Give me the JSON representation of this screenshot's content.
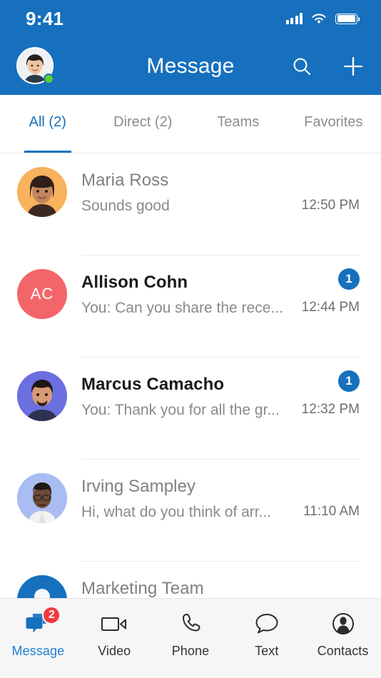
{
  "status_bar": {
    "time": "9:41",
    "signal_icon": "signal-bars-icon",
    "wifi_icon": "wifi-icon",
    "battery_icon": "battery-full-icon"
  },
  "header": {
    "title": "Message",
    "background_color": "#1670bd",
    "avatar_name": "user-avatar",
    "presence": "online",
    "presence_color": "#5ece2b",
    "search_icon": "search-icon",
    "add_icon": "plus-icon"
  },
  "tabs": {
    "active_index": 0,
    "accent_color": "#1670bd",
    "items": [
      {
        "label": "All (2)"
      },
      {
        "label": "Direct (2)"
      },
      {
        "label": "Teams"
      },
      {
        "label": "Favorites"
      }
    ]
  },
  "conversations": [
    {
      "name": "Maria Ross",
      "preview": "Sounds good",
      "time": "12:50 PM",
      "unread": "",
      "avatar_type": "photo",
      "avatar_color": "#f9b25e",
      "initials": ""
    },
    {
      "name": "Allison Cohn",
      "preview": "You: Can you share the rece...",
      "time": "12:44 PM",
      "unread": "1",
      "avatar_type": "initials",
      "avatar_color": "#f4656a",
      "initials": "AC"
    },
    {
      "name": "Marcus Camacho",
      "preview": "You: Thank you for all the gr...",
      "time": "12:32 PM",
      "unread": "1",
      "avatar_type": "photo",
      "avatar_color": "#6b6fe0",
      "initials": ""
    },
    {
      "name": "Irving Sampley",
      "preview": "Hi, what do you think of arr...",
      "time": "11:10 AM",
      "unread": "",
      "avatar_type": "photo",
      "avatar_color": "#a9bdf2",
      "initials": ""
    },
    {
      "name": "Marketing Team",
      "preview": "",
      "time": "",
      "unread": "",
      "avatar_type": "photo",
      "avatar_color": "#1670bd",
      "initials": ""
    }
  ],
  "bottom_nav": {
    "active_index": 0,
    "active_color": "#1d7fd1",
    "badge_color": "#ef3a3a",
    "items": [
      {
        "label": "Message",
        "icon": "message-bubbles-icon",
        "badge": "2"
      },
      {
        "label": "Video",
        "icon": "video-camera-icon",
        "badge": ""
      },
      {
        "label": "Phone",
        "icon": "phone-handset-icon",
        "badge": ""
      },
      {
        "label": "Text",
        "icon": "speech-bubble-icon",
        "badge": ""
      },
      {
        "label": "Contacts",
        "icon": "contact-person-icon",
        "badge": ""
      }
    ]
  }
}
